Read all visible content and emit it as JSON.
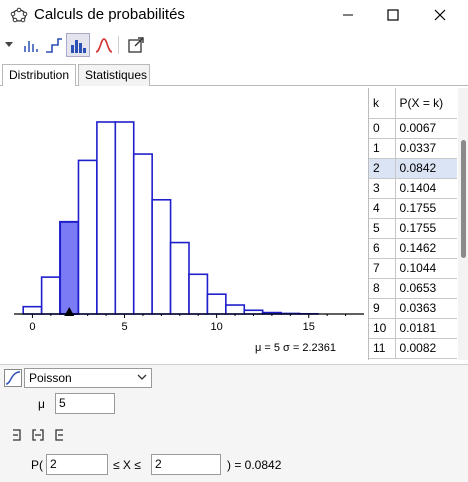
{
  "window": {
    "title": "Calculs de probabilités"
  },
  "tabs": {
    "distribution": "Distribution",
    "statistics": "Statistiques"
  },
  "stats": {
    "text": "μ = 5   σ = 2.2361"
  },
  "distribution": {
    "selected": "Poisson",
    "param_label": "μ",
    "param_value": "5"
  },
  "probability": {
    "prefix": "P(",
    "lower": "2",
    "op": "≤ X ≤",
    "upper": "2",
    "result": ") =  0.0842"
  },
  "table": {
    "header_k": "k",
    "header_p": "P(X = k)",
    "rows": [
      {
        "k": "0",
        "p": "0.0067"
      },
      {
        "k": "1",
        "p": "0.0337"
      },
      {
        "k": "2",
        "p": "0.0842"
      },
      {
        "k": "3",
        "p": "0.1404"
      },
      {
        "k": "4",
        "p": "0.1755"
      },
      {
        "k": "5",
        "p": "0.1755"
      },
      {
        "k": "6",
        "p": "0.1462"
      },
      {
        "k": "7",
        "p": "0.1044"
      },
      {
        "k": "8",
        "p": "0.0653"
      },
      {
        "k": "9",
        "p": "0.0363"
      },
      {
        "k": "10",
        "p": "0.0181"
      },
      {
        "k": "11",
        "p": "0.0082"
      }
    ]
  },
  "chart_data": {
    "type": "bar",
    "x": [
      0,
      1,
      2,
      3,
      4,
      5,
      6,
      7,
      8,
      9,
      10,
      11,
      12,
      13,
      14,
      15,
      16,
      17
    ],
    "values": [
      0.0067,
      0.0337,
      0.0842,
      0.1404,
      0.1755,
      0.1755,
      0.1462,
      0.1044,
      0.0653,
      0.0363,
      0.0181,
      0.0082,
      0.0034,
      0.0013,
      0.0005,
      0.0002,
      0.0,
      0.0
    ],
    "highlight": [
      2
    ],
    "xticks": [
      0,
      5,
      10,
      15
    ],
    "xlim": [
      -1,
      18
    ],
    "colors": {
      "bar_stroke": "#1f1fcc",
      "highlight_fill": "#7b7bf5",
      "axis": "#000000"
    }
  }
}
